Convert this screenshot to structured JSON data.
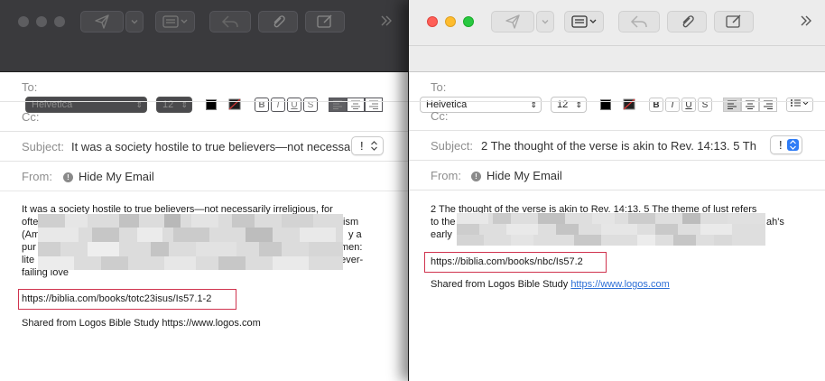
{
  "left_window": {
    "format": {
      "font": "Helvetica",
      "size": "12"
    },
    "fields": {
      "to_label": "To:",
      "cc_label": "Cc:",
      "subject_label": "Subject:",
      "subject_value": "It was a society hostile to true believers—not necessarily irreligious, for",
      "from_label": "From:",
      "from_value": "Hide My Email",
      "priority": "!"
    },
    "body": {
      "line1": "It was a society hostile to true believers—not necessarily irreligious, for",
      "line2_visible_start": "ofte",
      "line2_visible_end": "ism",
      "line3_visible_start": "(Am",
      "line3_visible_end": "y a",
      "line4_visible_start": "pur",
      "line4_visible_end": "men:",
      "line5_visible_start": "lite",
      "line5_visible_end": "never-",
      "line6": "failing love",
      "link": "https://biblia.com/books/totc23isus/Is57.1-2",
      "share_prefix": "Shared from Logos Bible Study ",
      "share_url": "https://www.logos.com"
    }
  },
  "right_window": {
    "format": {
      "font": "Helvetica",
      "size": "12"
    },
    "fields": {
      "to_label": "To:",
      "cc_label": "Cc:",
      "subject_label": "Subject:",
      "subject_value": "2 The thought of the verse is akin to Rev. 14:13. 5 Th",
      "from_label": "From:",
      "from_value": "Hide My Email",
      "priority": "!"
    },
    "body": {
      "line1": "2 The thought of the verse is akin to Rev. 14:13. 5 The theme of lust refers",
      "line2_visible_start": "to the",
      "line2_visible_end": "ah's",
      "line3_visible_start": "early",
      "link": "https://biblia.com/books/nbc/Is57.2",
      "share_prefix": "Shared from Logos Bible Study ",
      "share_url": "https://www.logos.com"
    }
  },
  "toolbar_icons": [
    "send-icon",
    "chevron-down-icon",
    "header-fields-icon",
    "reply-icon",
    "attachment-icon",
    "compose-format-icon",
    "overflow-chevrons-icon"
  ],
  "colors": {
    "highlight_border": "#d0344f",
    "link_blue": "#2d6fd6",
    "traffic_red": "#fe5f57",
    "traffic_yellow": "#febc2e",
    "traffic_green": "#28c840",
    "dark_chrome": "#3a3a3d"
  }
}
